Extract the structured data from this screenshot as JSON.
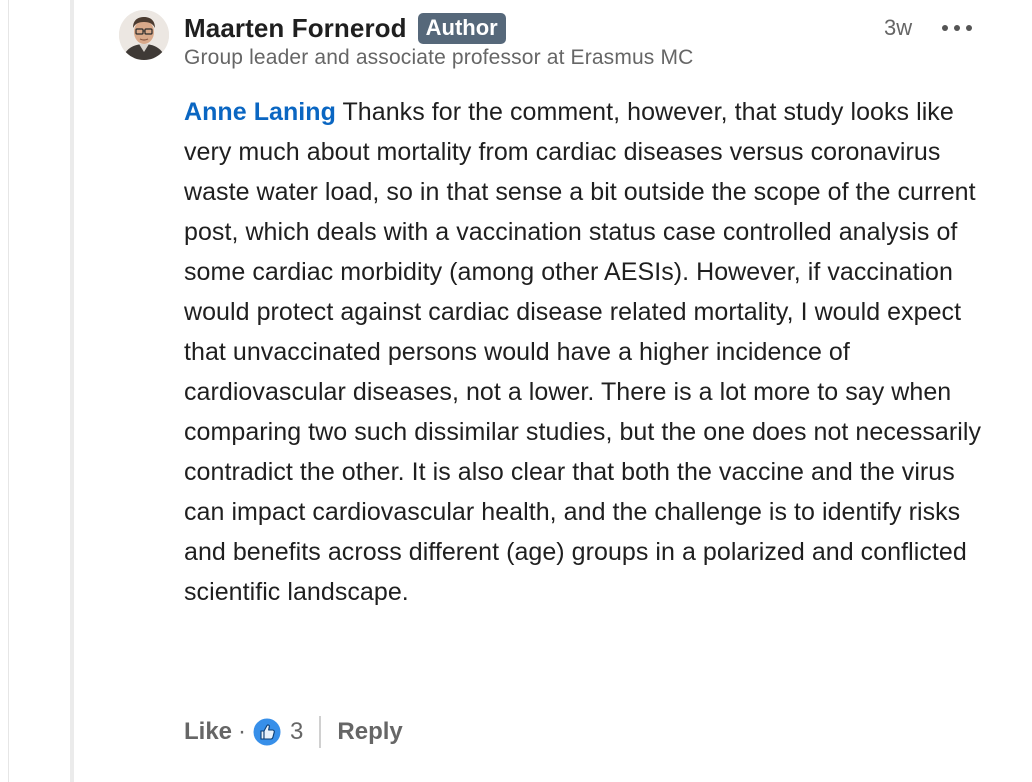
{
  "comment": {
    "author": {
      "name": "Maarten Fornerod",
      "badge": "Author",
      "headline": "Group leader and associate professor at Erasmus MC"
    },
    "timestamp": "3w",
    "mention": "Anne Laning",
    "text": " Thanks for the comment, however, that study looks like very much about mortality from cardiac diseases versus coronavirus waste water load, so in that sense a bit outside the scope of the current post, which deals with a vaccination status case controlled analysis of some cardiac morbidity (among other AESIs). However, if vaccination would protect against cardiac disease related mortality, I would expect that unvaccinated persons would have a higher incidence of cardiovascular diseases, not a lower. There is a lot more to say when comparing two such dissimilar studies, but the one does not necessarily contradict the other. It is also clear that both the vaccine and the virus can impact cardiovascular health, and the challenge is to identify risks and benefits across different (age) groups in a polarized and conflicted scientific landscape."
  },
  "actions": {
    "like_label": "Like",
    "separator": "·",
    "reaction_icon": "thumbs-up-icon",
    "reaction_count": "3",
    "reply_label": "Reply"
  },
  "colors": {
    "mention": "#0a66c2",
    "badge_bg": "#56687a",
    "reaction_blue": "#378fe9"
  }
}
